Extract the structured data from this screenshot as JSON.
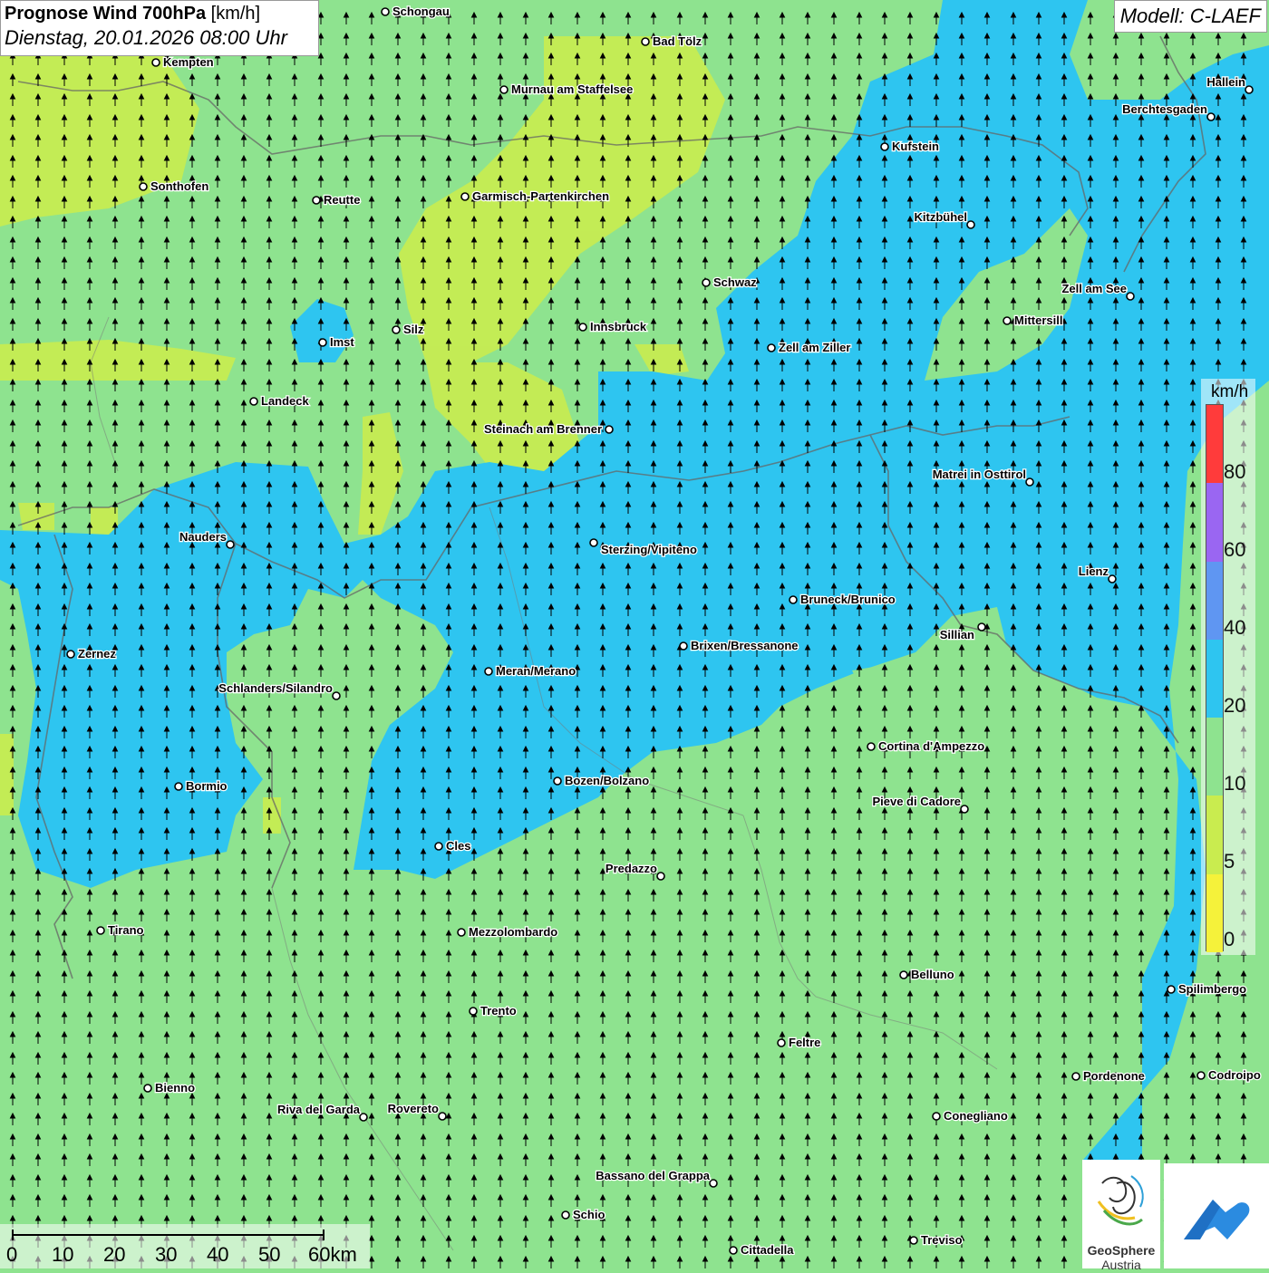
{
  "title": {
    "main": "Prognose Wind 700hPa",
    "unit": "[km/h]",
    "date": "Dienstag, 20.01.2026 08:00 Uhr"
  },
  "model": "Modell: C-LAEF",
  "legend": {
    "unit": "km/h",
    "labels": [
      "80",
      "60",
      "40",
      "20",
      "10",
      "5",
      "0"
    ],
    "colors": [
      "#ff3b3b",
      "#9a66f2",
      "#5f96f2",
      "#2ec5f0",
      "#8ee38f",
      "#c9ec4f",
      "#f5f23a"
    ]
  },
  "scalebar": {
    "labels": [
      "0",
      "10",
      "20",
      "30",
      "40",
      "50",
      "60km"
    ]
  },
  "logos": {
    "geosphere_line1": "GeoSphere",
    "geosphere_line2": "Austria"
  },
  "cities": [
    {
      "name": "Schongau"
    },
    {
      "name": "Bad Tölz"
    },
    {
      "name": "Kempten"
    },
    {
      "name": "Murnau am Staffelsee"
    },
    {
      "name": "Hallein"
    },
    {
      "name": "Berchtesgaden"
    },
    {
      "name": "Kufstein"
    },
    {
      "name": "Sonthofen"
    },
    {
      "name": "Reutte"
    },
    {
      "name": "Garmisch-Partenkirchen"
    },
    {
      "name": "Kitzbühel"
    },
    {
      "name": "Schwaz"
    },
    {
      "name": "Zell am See"
    },
    {
      "name": "Mittersill"
    },
    {
      "name": "Imst"
    },
    {
      "name": "Silz"
    },
    {
      "name": "Innsbruck"
    },
    {
      "name": "Zell am Ziller"
    },
    {
      "name": "Landeck"
    },
    {
      "name": "Steinach am Brenner"
    },
    {
      "name": "Matrei in Osttirol"
    },
    {
      "name": "Nauders"
    },
    {
      "name": "Sterzing/Vipiteno"
    },
    {
      "name": "Lienz"
    },
    {
      "name": "Bruneck/Brunico"
    },
    {
      "name": "Sillian"
    },
    {
      "name": "Zernez"
    },
    {
      "name": "Brixen/Bressanone"
    },
    {
      "name": "Meran/Merano"
    },
    {
      "name": "Schlanders/Silandro"
    },
    {
      "name": "Cortina d'Ampezzo"
    },
    {
      "name": "Bozen/Bolzano"
    },
    {
      "name": "Bormio"
    },
    {
      "name": "Pieve di Cadore"
    },
    {
      "name": "Cles"
    },
    {
      "name": "Predazzo"
    },
    {
      "name": "Tirano"
    },
    {
      "name": "Mezzolombardo"
    },
    {
      "name": "Belluno"
    },
    {
      "name": "Spilimbergo"
    },
    {
      "name": "Trento"
    },
    {
      "name": "Feltre"
    },
    {
      "name": "Pordenone"
    },
    {
      "name": "Codroipo"
    },
    {
      "name": "Bienno"
    },
    {
      "name": "Riva del Garda"
    },
    {
      "name": "Rovereto"
    },
    {
      "name": "Conegliano"
    },
    {
      "name": "Bassano del Grappa"
    },
    {
      "name": "Schio"
    },
    {
      "name": "Treviso"
    },
    {
      "name": "Cittadella"
    }
  ]
}
